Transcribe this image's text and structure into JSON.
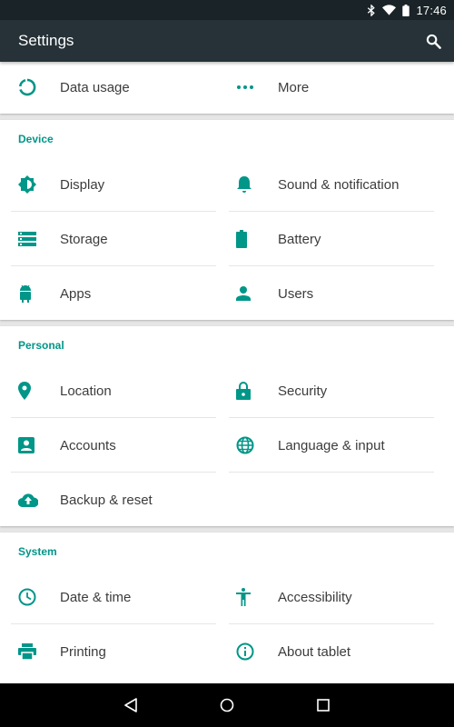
{
  "status_bar": {
    "time": "17:46",
    "icons": [
      "bluetooth-icon",
      "wifi-icon",
      "battery-icon"
    ]
  },
  "app_bar": {
    "title": "Settings",
    "search_icon": "search-icon"
  },
  "accent_color": "#009688",
  "top_card": {
    "items": [
      {
        "label": "Data usage",
        "icon": "data-usage-icon"
      },
      {
        "label": "More",
        "icon": "more-dots-icon"
      }
    ]
  },
  "sections": [
    {
      "title": "Device",
      "items": [
        {
          "label": "Display",
          "icon": "brightness-icon"
        },
        {
          "label": "Sound & notification",
          "icon": "bell-icon"
        },
        {
          "label": "Storage",
          "icon": "storage-icon"
        },
        {
          "label": "Battery",
          "icon": "battery-icon"
        },
        {
          "label": "Apps",
          "icon": "android-icon"
        },
        {
          "label": "Users",
          "icon": "person-icon"
        }
      ]
    },
    {
      "title": "Personal",
      "items": [
        {
          "label": "Location",
          "icon": "location-pin-icon"
        },
        {
          "label": "Security",
          "icon": "lock-icon"
        },
        {
          "label": "Accounts",
          "icon": "account-box-icon"
        },
        {
          "label": "Language & input",
          "icon": "globe-icon"
        },
        {
          "label": "Backup & reset",
          "icon": "cloud-upload-icon"
        }
      ]
    },
    {
      "title": "System",
      "items": [
        {
          "label": "Date & time",
          "icon": "clock-icon"
        },
        {
          "label": "Accessibility",
          "icon": "accessibility-icon"
        },
        {
          "label": "Printing",
          "icon": "printer-icon"
        },
        {
          "label": "About tablet",
          "icon": "info-icon"
        }
      ]
    }
  ],
  "nav_bar": {
    "buttons": [
      "back-icon",
      "home-icon",
      "recents-icon"
    ]
  }
}
